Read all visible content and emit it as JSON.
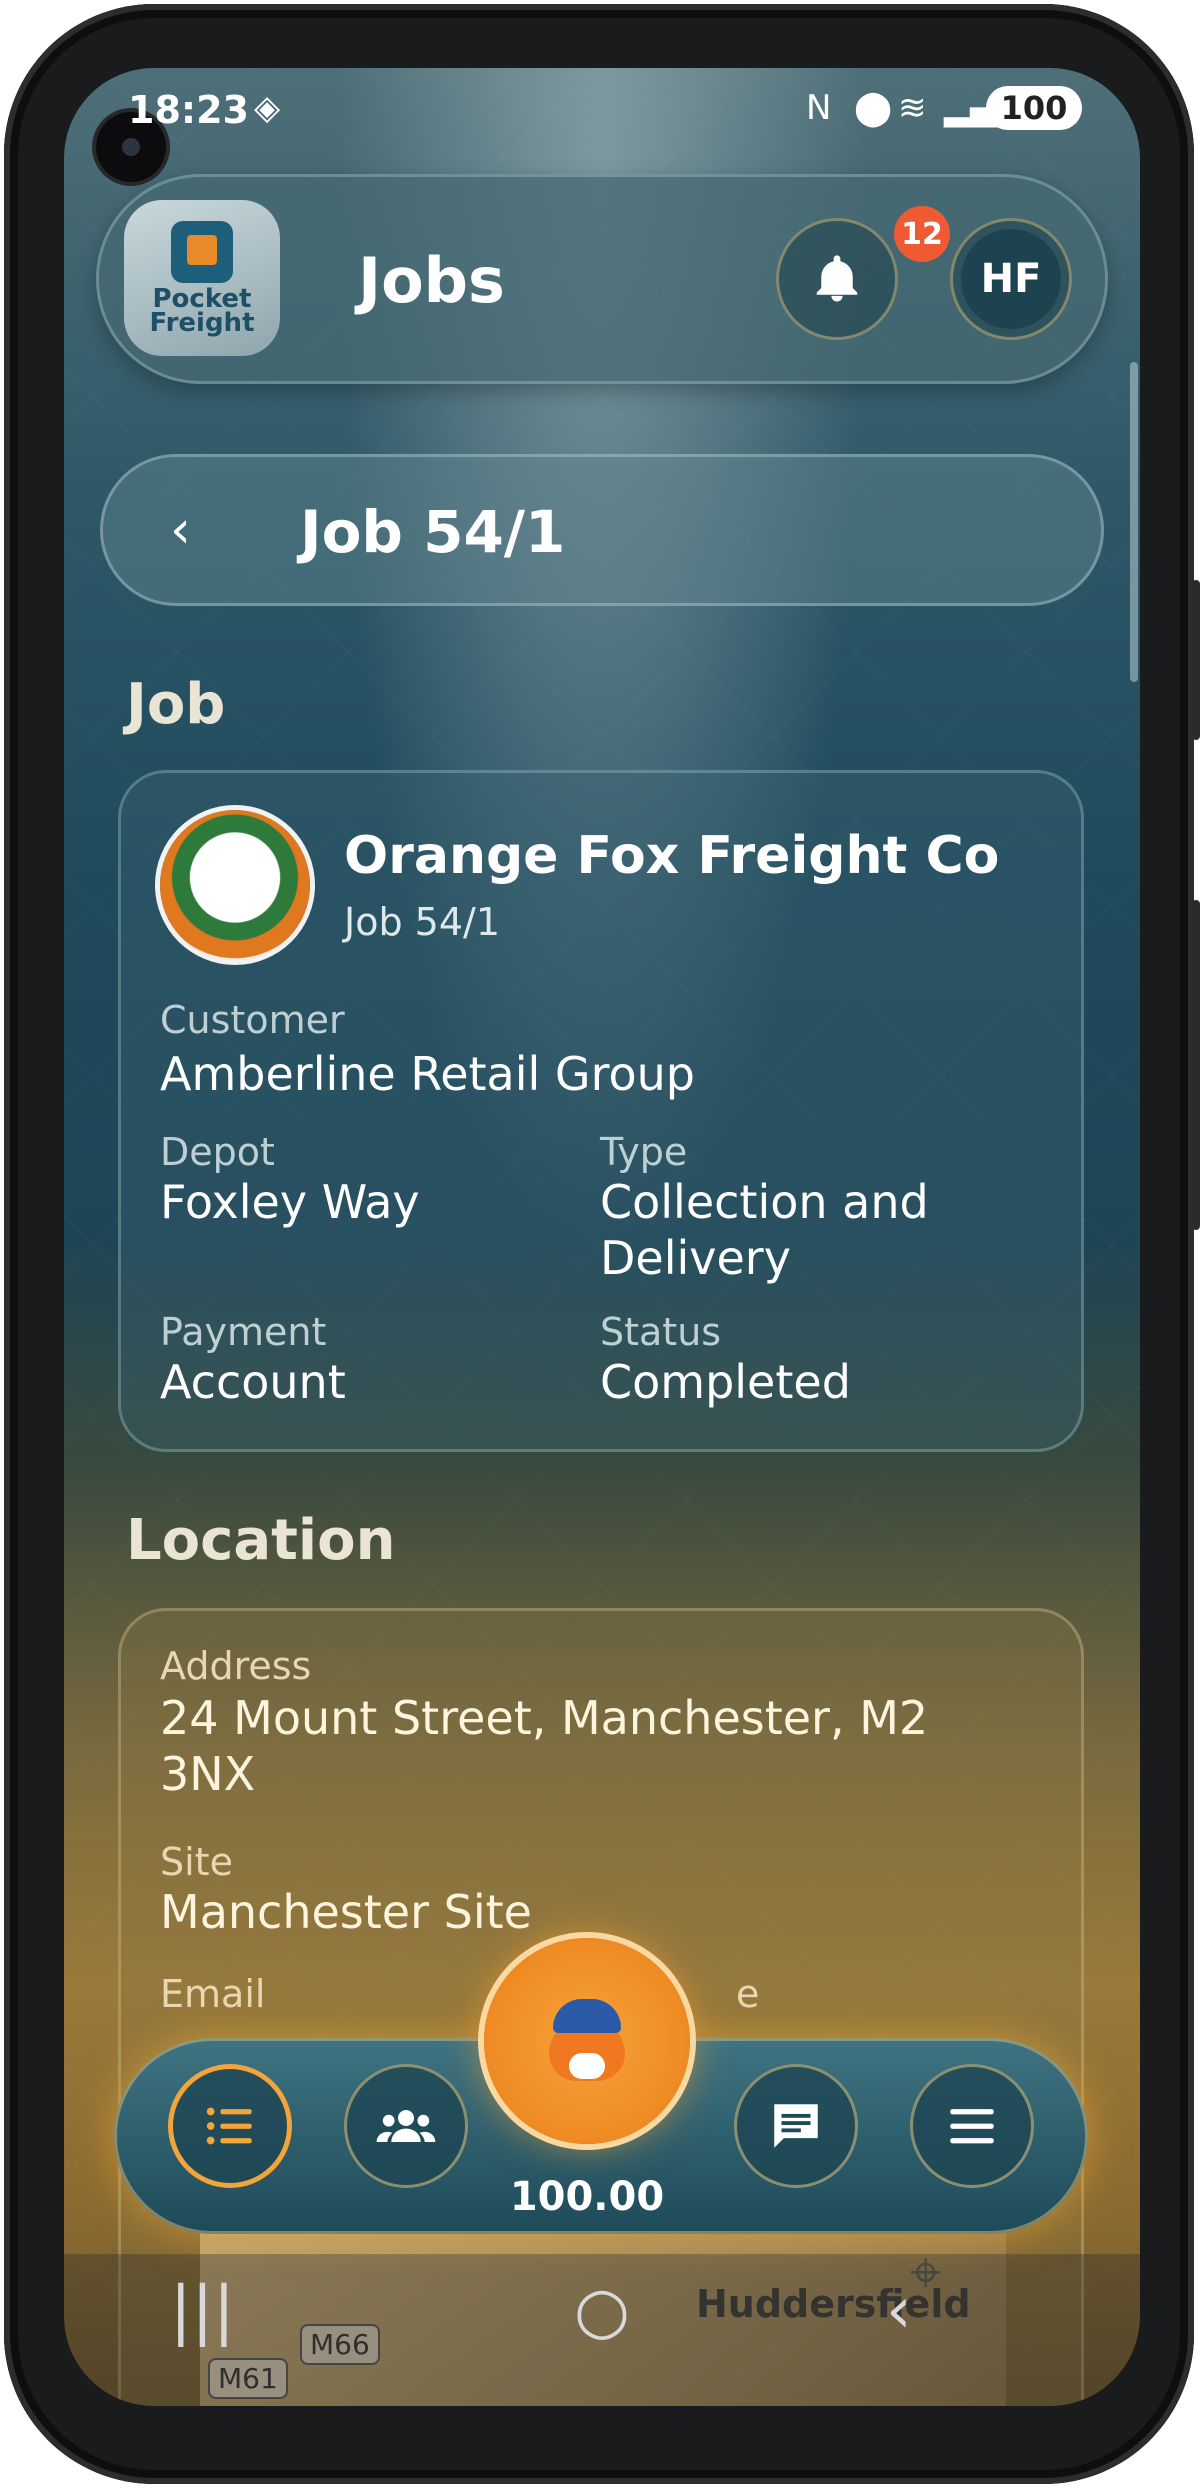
{
  "status_bar": {
    "time": "18:23",
    "battery": "100"
  },
  "header": {
    "logo_text_line1": "Pocket",
    "logo_text_line2": "Freight",
    "title": "Jobs",
    "notification_count": "12",
    "avatar_initials": "HF"
  },
  "back_bar": {
    "title": "Job 54/1"
  },
  "job_section": {
    "heading": "Job",
    "company_name": "Orange Fox Freight Co",
    "job_ref": "Job 54/1",
    "customer_label": "Customer",
    "customer_value": "Amberline Retail Group",
    "depot_label": "Depot",
    "depot_value": "Foxley Way",
    "type_label": "Type",
    "type_value": "Collection and Delivery",
    "payment_label": "Payment",
    "payment_value": "Account",
    "status_label": "Status",
    "status_value": "Completed"
  },
  "location_section": {
    "heading": "Location",
    "address_label": "Address",
    "address_value": "24 Mount Street, Manchester, M2 3NX",
    "site_label": "Site",
    "site_value": "Manchester Site",
    "email_label": "Email",
    "phone_label_partial": "e"
  },
  "bottom_nav": {
    "balance": "100.00",
    "items": [
      "jobs-list",
      "contacts",
      "fox-wallet",
      "messages",
      "menu"
    ]
  },
  "map": {
    "label": "Huddersfield",
    "road_1": "M66",
    "road_2": "M61"
  },
  "colors": {
    "accent_orange": "#f3a43a",
    "badge_red": "#f05a32",
    "teal_bg": "#1f4a5c"
  }
}
